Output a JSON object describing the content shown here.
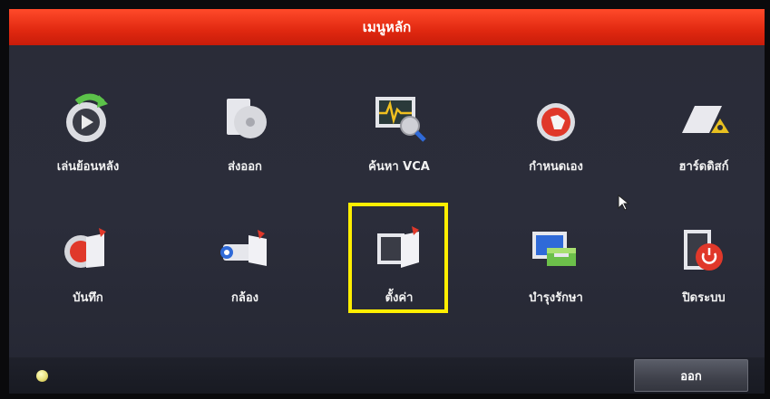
{
  "window": {
    "title": "เมนูหลัก"
  },
  "menu": {
    "row1": [
      {
        "key": "playback",
        "label": "เล่นย้อนหลัง",
        "icon": "playback-icon"
      },
      {
        "key": "export",
        "label": "ส่งออก",
        "icon": "export-icon"
      },
      {
        "key": "vca-search",
        "label": "ค้นหา VCA",
        "icon": "vca-search-icon"
      },
      {
        "key": "custom",
        "label": "กำหนดเอง",
        "icon": "custom-icon"
      },
      {
        "key": "hdd",
        "label": "ฮาร์ดดิสก์",
        "icon": "hdd-icon"
      }
    ],
    "row2": [
      {
        "key": "record",
        "label": "บันทึก",
        "icon": "record-icon"
      },
      {
        "key": "camera",
        "label": "กล้อง",
        "icon": "camera-icon"
      },
      {
        "key": "settings",
        "label": "ตั้งค่า",
        "icon": "settings-icon",
        "selected": true
      },
      {
        "key": "maintenance",
        "label": "บำรุงรักษา",
        "icon": "maintenance-icon"
      },
      {
        "key": "shutdown",
        "label": "ปิดระบบ",
        "icon": "shutdown-icon"
      }
    ]
  },
  "footer": {
    "exit_label": "ออก"
  },
  "colors": {
    "titlebar": "#e02810",
    "background": "#2b2d3a",
    "highlight": "#ffee00",
    "text": "#f2f2f2"
  }
}
